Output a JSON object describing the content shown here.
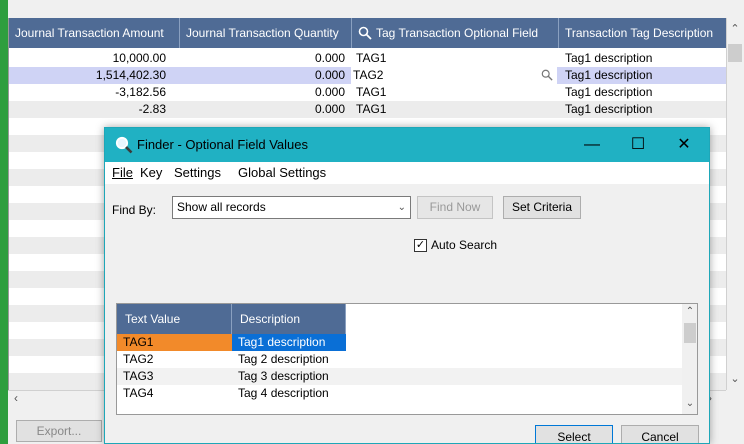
{
  "grid": {
    "columns": [
      "Journal Transaction Amount",
      "Journal Transaction Quantity",
      "Tag Transaction Optional Field",
      "Transaction Tag Description"
    ],
    "rows": [
      {
        "amount": "10,000.00",
        "quantity": "0.000",
        "tag": "TAG1",
        "description": "Tag1 description"
      },
      {
        "amount": "1,514,402.30",
        "quantity": "0.000",
        "tag": "TAG2",
        "description": "Tag1 description"
      },
      {
        "amount": "-3,182.56",
        "quantity": "0.000",
        "tag": "TAG1",
        "description": "Tag1 description"
      },
      {
        "amount": "-2.83",
        "quantity": "0.000",
        "tag": "TAG1",
        "description": "Tag1 description"
      }
    ],
    "export_label": "Export..."
  },
  "finder": {
    "title": "Finder - Optional Field Values",
    "menu": {
      "file": "File",
      "key": "Key",
      "settings": "Settings",
      "global_settings": "Global Settings"
    },
    "find_by_label": "Find By:",
    "find_by_value": "Show all records",
    "find_now_label": "Find Now",
    "set_criteria_label": "Set Criteria",
    "auto_search_label": "Auto Search",
    "auto_search_checked": true,
    "list_columns": [
      "Text Value",
      "Description"
    ],
    "list_rows": [
      {
        "value": "TAG1",
        "description": "Tag1 description"
      },
      {
        "value": "TAG2",
        "description": "Tag 2 description"
      },
      {
        "value": "TAG3",
        "description": "Tag 3 description"
      },
      {
        "value": "TAG4",
        "description": "Tag 4 description"
      }
    ],
    "select_label": "Select",
    "cancel_label": "Cancel"
  },
  "colors": {
    "header_bg": "#4f6b95",
    "titlebar": "#20b1c3",
    "selected_row": "#cfd3f5",
    "selected_cell_value": "#f28a2a",
    "selected_cell_desc": "#0a6fd6",
    "accent_green": "#2e9e3e"
  },
  "icons": {
    "search": "magnifier-icon",
    "minimize": "minimize-icon",
    "maximize": "maximize-icon",
    "close": "close-icon"
  }
}
